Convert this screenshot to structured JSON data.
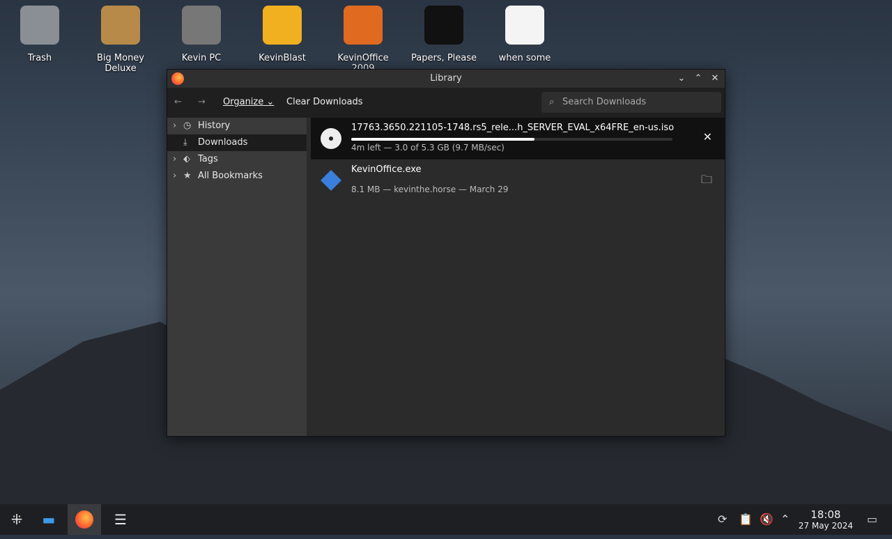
{
  "desktop": {
    "icons": [
      {
        "label": "Trash",
        "color": "#8a8f96"
      },
      {
        "label": "Big Money Deluxe",
        "color": "#b78a4a"
      },
      {
        "label": "Kevin PC",
        "color": "#777"
      },
      {
        "label": "KevinBlast",
        "color": "#f0b020"
      },
      {
        "label": "KevinOffice 2009",
        "color": "#e06a20"
      },
      {
        "label": "Papers, Please",
        "color": "#111"
      },
      {
        "label": "when some",
        "color": "#f4f4f4"
      }
    ]
  },
  "window": {
    "title": "Library"
  },
  "toolbar": {
    "organize": "Organize",
    "clear": "Clear Downloads",
    "search_placeholder": "Search Downloads"
  },
  "sidebar": {
    "items": [
      {
        "label": "History",
        "icon": "clock-icon"
      },
      {
        "label": "Downloads",
        "icon": "download-icon"
      },
      {
        "label": "Tags",
        "icon": "tag-icon"
      },
      {
        "label": "All Bookmarks",
        "icon": "star-icon"
      }
    ]
  },
  "downloads": [
    {
      "name": "17763.3650.221105-1748.rs5_rele...h_SERVER_EVAL_x64FRE_en-us.iso",
      "status": "4m left — 3.0 of 5.3 GB (9.7 MB/sec)",
      "progress": 0.57
    },
    {
      "name": "KevinOffice.exe",
      "status": "8.1 MB — kevinthe.horse — March 29"
    }
  ],
  "taskbar": {
    "time": "18:08",
    "date": "27 May 2024"
  }
}
